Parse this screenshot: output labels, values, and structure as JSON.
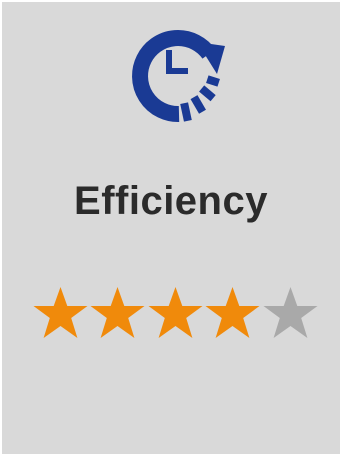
{
  "card": {
    "title": "Efficiency",
    "icon": "clock-refresh-icon"
  },
  "rating": {
    "value": 4,
    "max": 5
  },
  "colors": {
    "background": "#d9d9d9",
    "icon": "#1a3a94",
    "title": "#2b2b2b",
    "star_filled": "#f08a0b",
    "star_empty": "#a9a9a9"
  }
}
